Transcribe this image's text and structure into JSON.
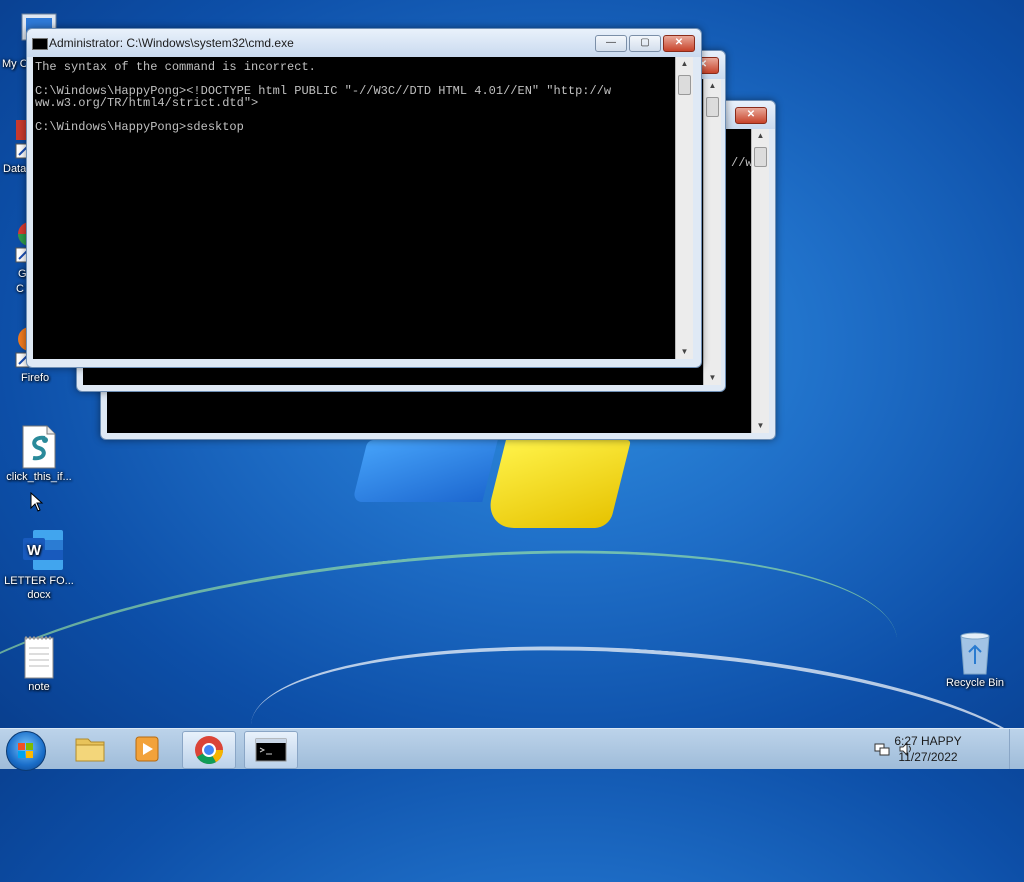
{
  "desktop": {
    "partial_labels": {
      "my_computer": "My C",
      "data": "Data",
      "chrome_1": "G",
      "chrome_2": "C",
      "firefox": "Firefo"
    },
    "icons": [
      {
        "name": "click-this-file",
        "label": "click_this_if..."
      },
      {
        "name": "letter-doc",
        "label_1": "LETTER FO...",
        "label_2": "docx"
      },
      {
        "name": "note",
        "label": "note"
      },
      {
        "name": "recycle-bin",
        "label": "Recycle Bin"
      }
    ]
  },
  "windows": {
    "front": {
      "title": "Administrator: C:\\Windows\\system32\\cmd.exe",
      "lines": [
        "The syntax of the command is incorrect.",
        "",
        "C:\\Windows\\HappyPong>",
        "ww.w3.org/TR/html4/strict.dtd\">",
        "",
        "C:\\Windows\\HappyPong>sdesktop"
      ],
      "line3_tail": "<!DOCTYPE html PUBLIC \"-//W3C//DTD HTML 4.01//EN\" \"http://w"
    },
    "back_1": {
      "fragment": "//w"
    },
    "ctrl": {
      "minimize": "—",
      "maximize": "▢",
      "close": "✕"
    }
  },
  "taskbar": {
    "clock_time": "6:27 HAPPY",
    "clock_date": "11/27/2022"
  },
  "colors": {
    "console_bg": "#000000",
    "console_fg": "#c0c0c0",
    "close_red": "#c7432a"
  }
}
